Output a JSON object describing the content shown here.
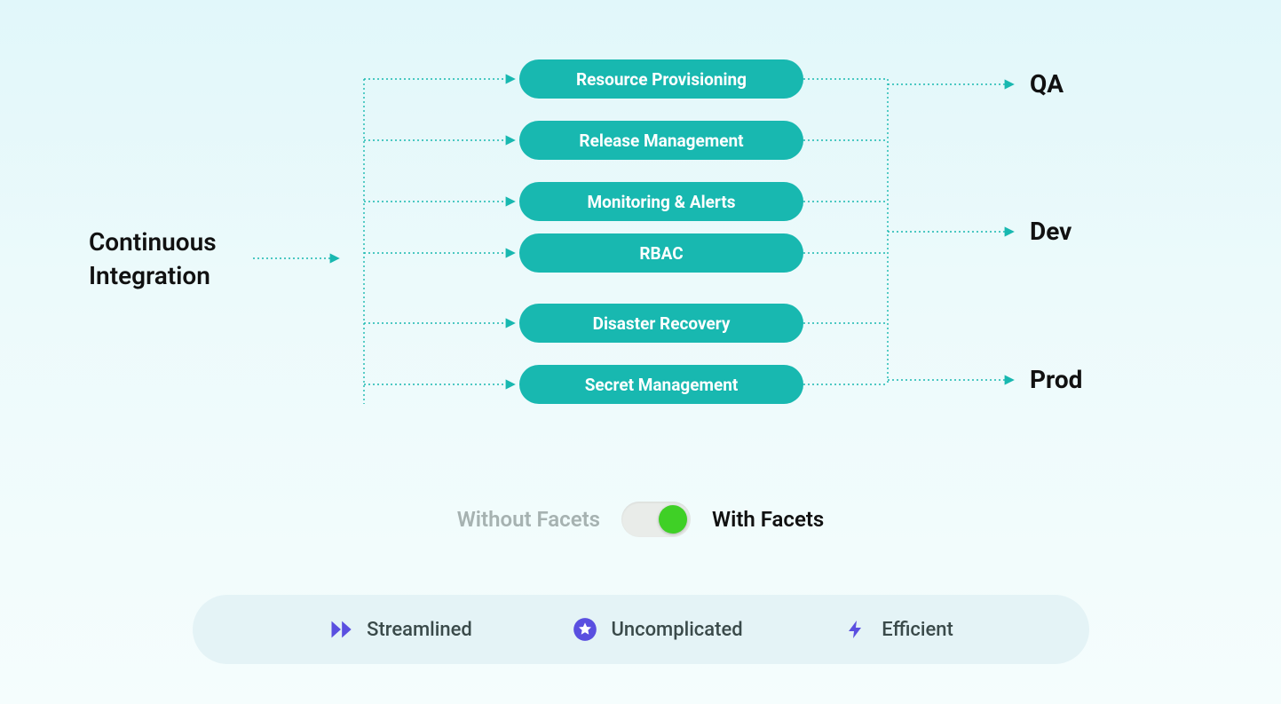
{
  "colors": {
    "teal": "#18b8b0",
    "indigo": "#5a4fe0",
    "toggle_on": "#3fd026"
  },
  "diagram": {
    "source_label": "Continuous\nIntegration",
    "pills": [
      "Resource Provisioning",
      "Release Management",
      "Monitoring & Alerts",
      "RBAC",
      "Disaster Recovery",
      "Secret Management"
    ],
    "targets": [
      "QA",
      "Dev",
      "Prod"
    ]
  },
  "toggle": {
    "off_label": "Without Facets",
    "on_label": "With Facets",
    "state": "on"
  },
  "features": [
    {
      "icon": "fast-forward-icon",
      "label": "Streamlined"
    },
    {
      "icon": "star-badge-icon",
      "label": "Uncomplicated"
    },
    {
      "icon": "lightning-icon",
      "label": "Efficient"
    }
  ]
}
